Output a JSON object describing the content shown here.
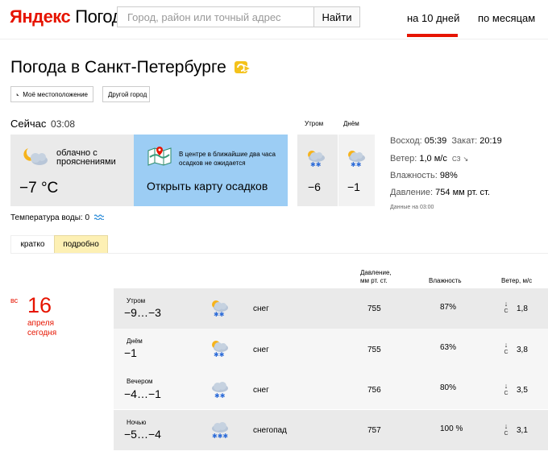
{
  "header": {
    "logo_brand": "Яндекс",
    "logo_product": "Погода",
    "search_placeholder": "Город, район или точный адрес",
    "search_button": "Найти",
    "nav_10_days": "на 10 дней",
    "nav_by_month": "по месяцам"
  },
  "title": "Погода в Санкт-Петербурге",
  "buttons": {
    "my_location": "Моё местоположение",
    "other_city": "Другой город"
  },
  "now": {
    "label": "Сейчас",
    "time": "03:08",
    "condition": "облачно с прояснениями",
    "temp": "−7 °C",
    "map_note": "В центре в ближайшие два часа осадков не ожидается",
    "map_link": "Открыть карту осадков",
    "water_temp": "Температура воды: 0"
  },
  "parts": [
    {
      "label": "Утром",
      "temp": "−6"
    },
    {
      "label": "Днём",
      "temp": "−1"
    }
  ],
  "info": {
    "sunrise_label": "Восход:",
    "sunrise": "05:39",
    "sunset_label": "Закат:",
    "sunset": "20:19",
    "wind_label": "Ветер:",
    "wind": "1,0 м/с",
    "wind_dir": "СЗ",
    "humidity_label": "Влажность:",
    "humidity": "98%",
    "pressure_label": "Давление:",
    "pressure": "754 мм рт. ст.",
    "data_at": "Данные на 03:00"
  },
  "tabs": {
    "short": "кратко",
    "detailed": "подробно"
  },
  "forecast_head": {
    "pressure_1": "Давление,",
    "pressure_2": "мм рт. ст.",
    "humidity": "Влажность",
    "wind": "Ветер, м/с"
  },
  "day": {
    "dow": "вс",
    "number": "16",
    "month": "апреля",
    "note": "сегодня"
  },
  "rows": [
    {
      "part": "Утром",
      "temp": "−9…−3",
      "cond": "снег",
      "pressure": "755",
      "humidity": "87%",
      "wind_dir": "С",
      "wind": "1,8"
    },
    {
      "part": "Днём",
      "temp": "−1",
      "cond": "снег",
      "pressure": "755",
      "humidity": "63%",
      "wind_dir": "С",
      "wind": "3,8"
    },
    {
      "part": "Вечером",
      "temp": "−4…−1",
      "cond": "снег",
      "pressure": "756",
      "humidity": "80%",
      "wind_dir": "С",
      "wind": "3,5"
    },
    {
      "part": "Ночью",
      "temp": "−5…−4",
      "cond": "снегопад",
      "pressure": "757",
      "humidity": "100 %",
      "wind_dir": "С",
      "wind": "3,1"
    }
  ],
  "colors": {
    "accent": "#e61400",
    "map": "#9ccdf4",
    "tab_active": "#fdf0b4",
    "snow": "#2a6ad8",
    "sun": "#f6b31c"
  }
}
